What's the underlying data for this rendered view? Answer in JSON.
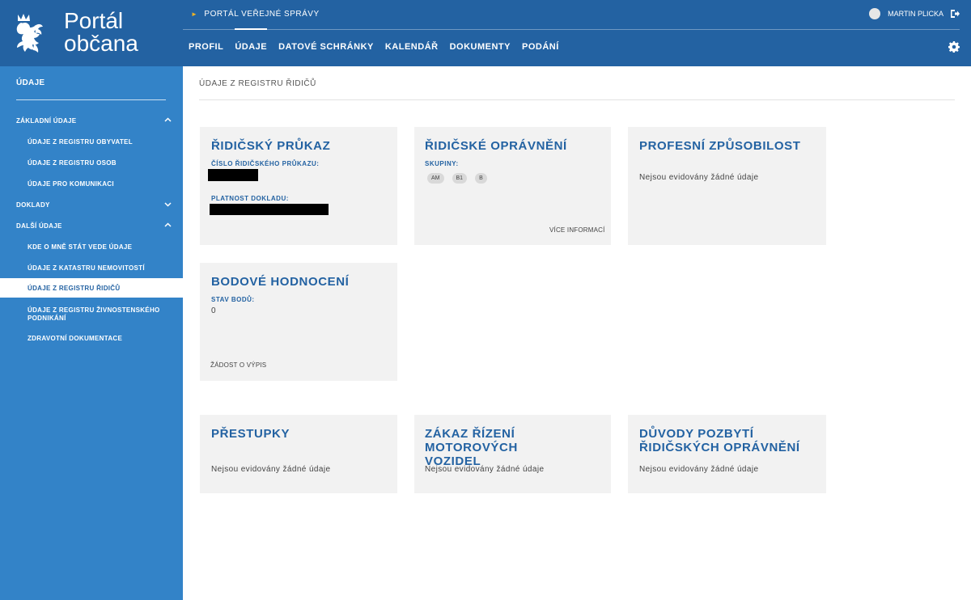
{
  "header": {
    "brand_line1": "Portál",
    "brand_line2": "občana",
    "top_link": "PORTÁL VEŘEJNÉ SPRÁVY",
    "user_name": "MARTIN PLICKA",
    "nav": [
      "PROFIL",
      "ÚDAJE",
      "DATOVÉ SCHRÁNKY",
      "KALENDÁŘ",
      "DOKUMENTY",
      "PODÁNÍ"
    ],
    "active_tab": "ÚDAJE"
  },
  "sidebar": {
    "title": "ÚDAJE",
    "items": [
      {
        "label": "ZÁKLADNÍ ÚDAJE",
        "level": 1,
        "chevron": "up"
      },
      {
        "label": "ÚDAJE Z REGISTRU OBYVATEL",
        "level": 2
      },
      {
        "label": "ÚDAJE Z REGISTRU OSOB",
        "level": 2
      },
      {
        "label": "ÚDAJE PRO KOMUNIKACI",
        "level": 2
      },
      {
        "label": "DOKLADY",
        "level": 1,
        "chevron": "down"
      },
      {
        "label": "DALŠÍ ÚDAJE",
        "level": 1,
        "chevron": "up"
      },
      {
        "label": "KDE O MNĚ STÁT VEDE ÚDAJE",
        "level": 2
      },
      {
        "label": "ÚDAJE Z KATASTRU NEMOVITOSTÍ",
        "level": 2
      },
      {
        "label": "ÚDAJE Z REGISTRU ŘIDIČŮ",
        "level": 2,
        "active": true
      },
      {
        "label": "ÚDAJE Z REGISTRU ŽIVNOSTENSKÉHO",
        "label2": "PODNIKÁNÍ",
        "level": 2
      },
      {
        "label": "ZDRAVOTNÍ DOKUMENTACE",
        "level": 2
      }
    ]
  },
  "main": {
    "page_title": "ÚDAJE Z REGISTRU ŘIDIČŮ",
    "cards": {
      "license": {
        "title": "ŘIDIČSKÝ PRŮKAZ",
        "number_label": "ČÍSLO ŘIDIČSKÉHO PRŮKAZU:",
        "validity_label": "PLATNOST DOKLADU:"
      },
      "authorization": {
        "title": "ŘIDIČSKÉ OPRÁVNĚNÍ",
        "groups_label": "SKUPINY:",
        "groups": [
          "AM",
          "B1",
          "B"
        ],
        "more_link": "VÍCE INFORMACÍ"
      },
      "professional": {
        "title": "PROFESNÍ ZPŮSOBILOST",
        "empty": "Nejsou evidovány žádné údaje"
      },
      "points": {
        "title": "BODOVÉ HODNOCENÍ",
        "state_label": "STAV BODŮ:",
        "state_value": "0",
        "request_link": "ŽÁDOST O VÝPIS"
      },
      "offenses": {
        "title": "PŘESTUPKY",
        "empty": "Nejsou evidovány žádné údaje"
      },
      "ban": {
        "title_line1": "ZÁKAZ ŘÍZENÍ MOTOROVÝCH",
        "title_line2": "VOZIDEL",
        "empty": "Nejsou evidovány žádné údaje"
      },
      "reasons": {
        "title_line1": "DŮVODY POZBYTÍ",
        "title_line2": "ŘIDIČSKÝCH OPRÁVNĚNÍ",
        "empty": "Nejsou evidovány žádné údaje"
      }
    }
  },
  "colors": {
    "header_bg": "#2362a2",
    "sidebar_bg": "#3383c8",
    "accent_arrow": "#f0b323",
    "card_bg": "#f2f2f2",
    "title_blue": "#2362a2"
  }
}
